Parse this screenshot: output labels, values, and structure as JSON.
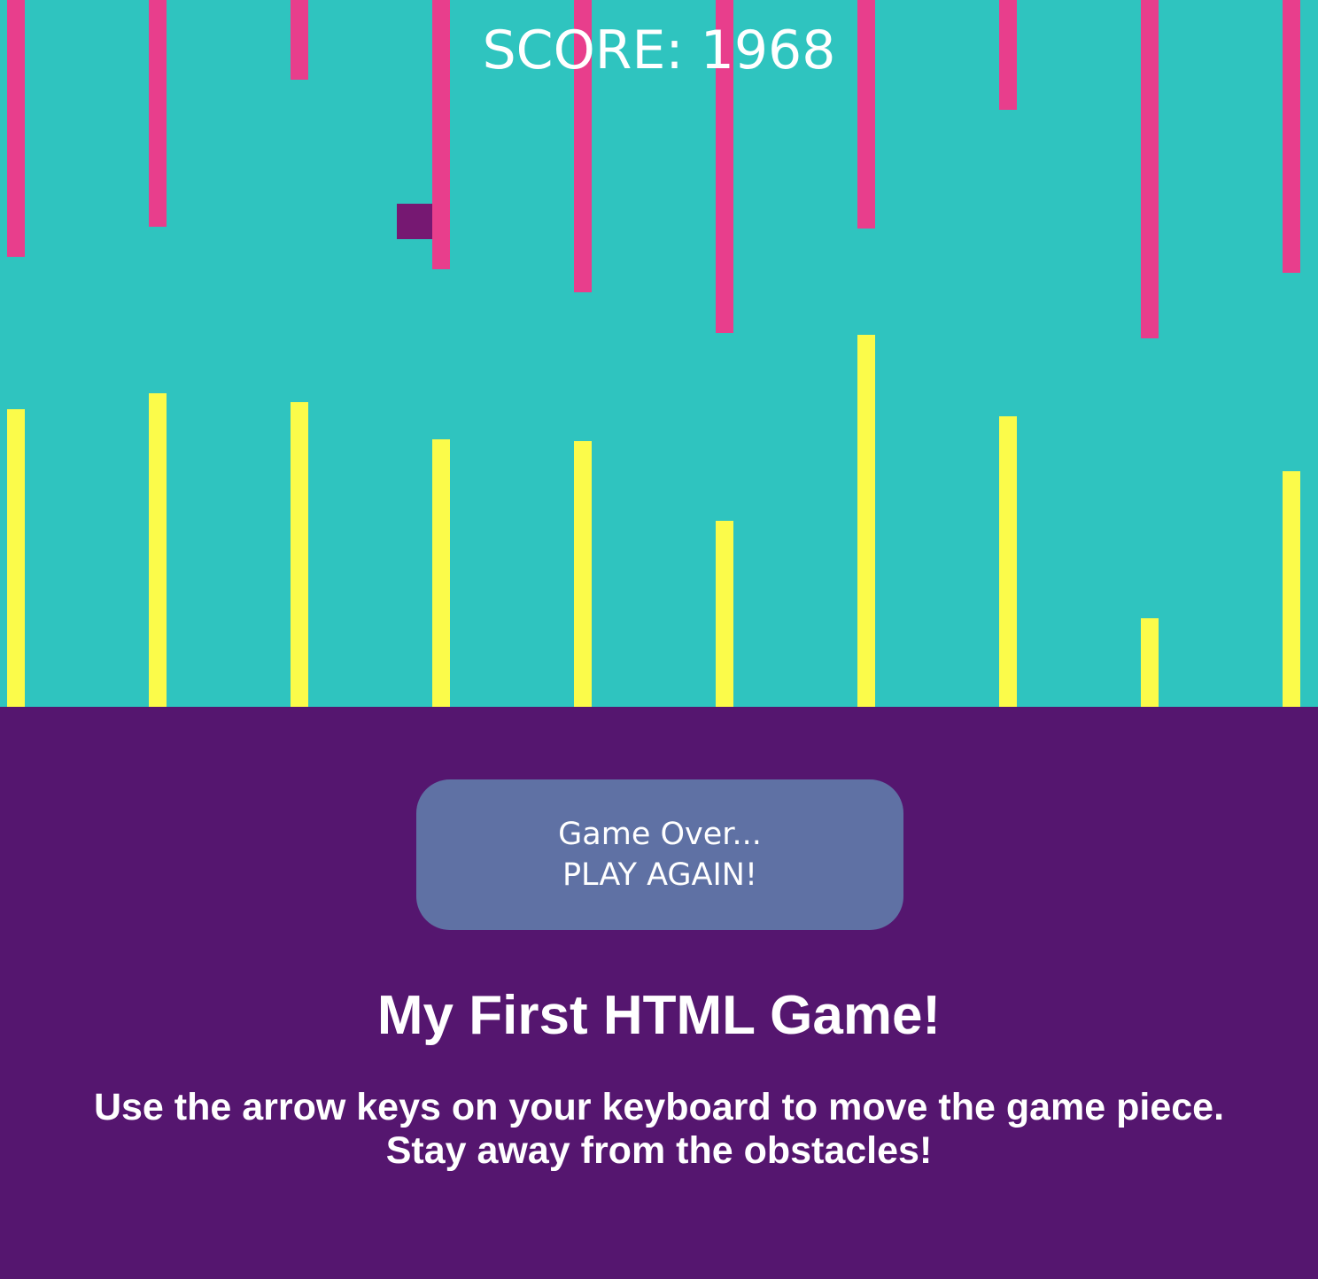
{
  "game": {
    "score_text": "SCORE: 1968",
    "colors": {
      "background": "#2fc4bf",
      "top_obstacle": "#e83e8c",
      "bottom_obstacle": "#fbfb4a",
      "player": "#761872",
      "page_background": "#55166f",
      "button_background": "#5f71a4"
    }
  },
  "button": {
    "line1": "Game Over...",
    "line2": "PLAY AGAIN!"
  },
  "title": "My First HTML Game!",
  "instructions": "Use the arrow keys on your keyboard to move the game piece. Stay away from the obstacles!"
}
